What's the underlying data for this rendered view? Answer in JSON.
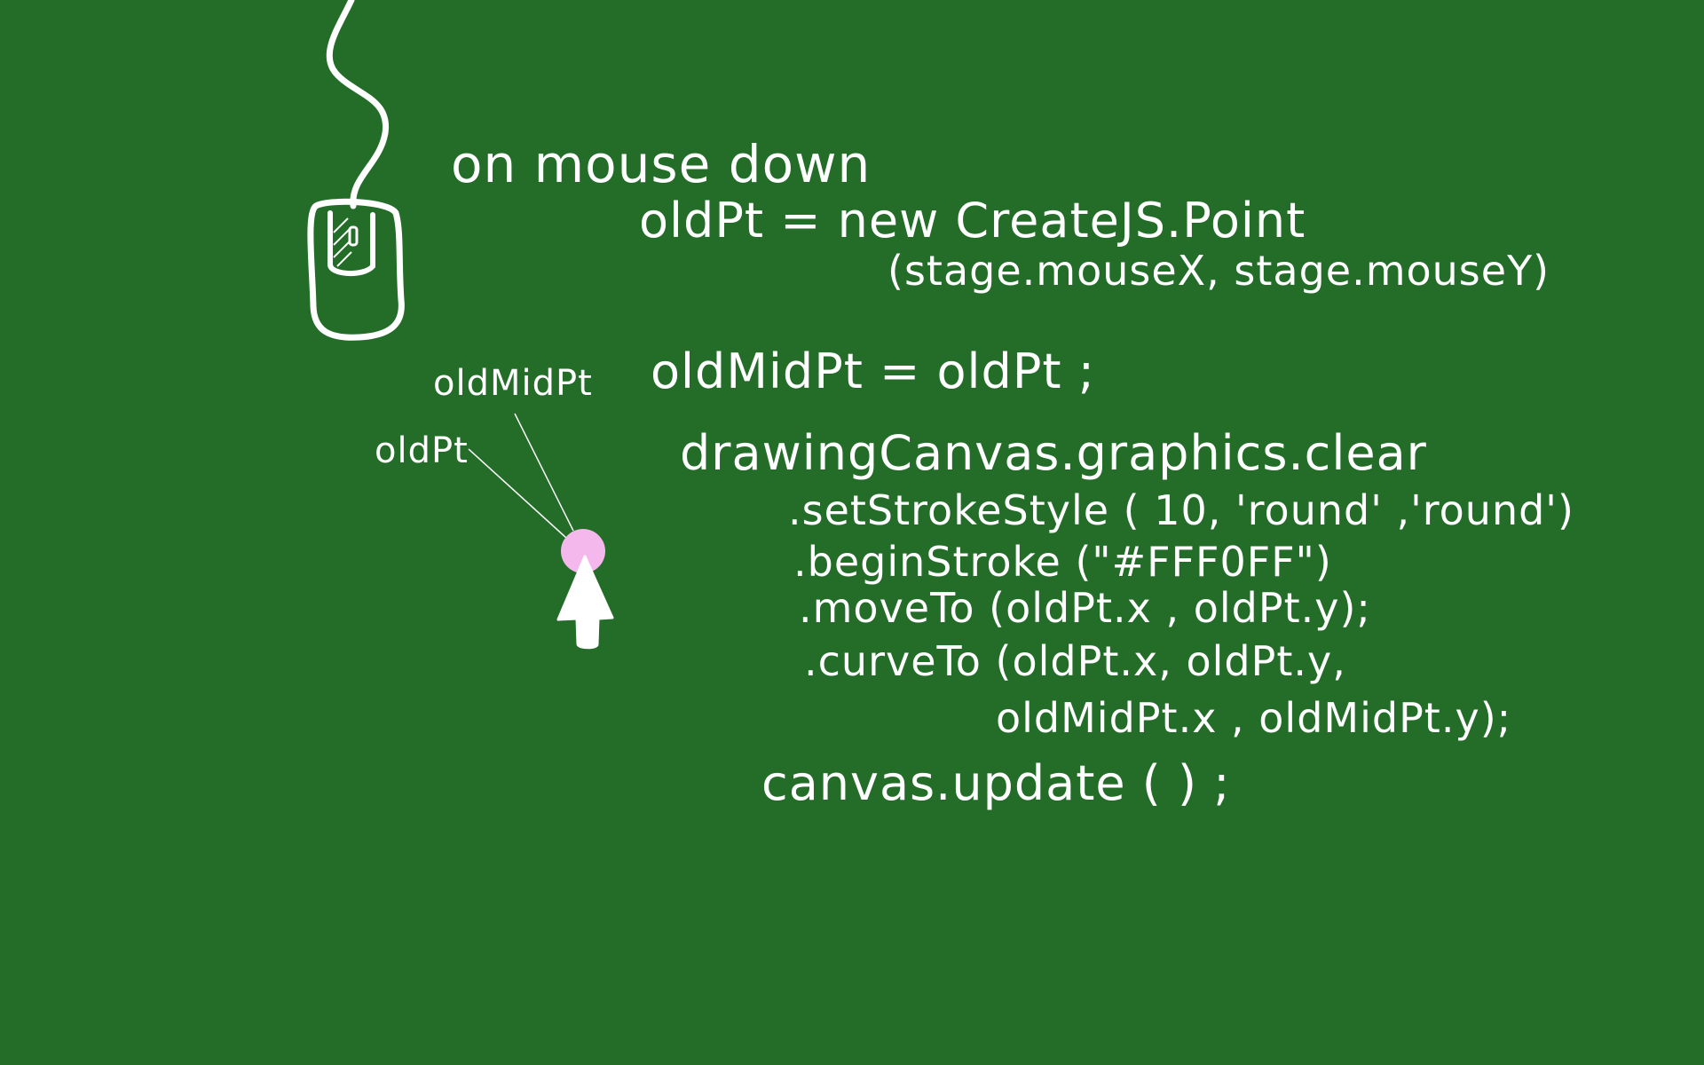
{
  "colors": {
    "board": "#236d29",
    "chalk": "#ffffff",
    "cursor_dot": "#f4b8ec"
  },
  "icons": {
    "mouse": "mouse-icon",
    "cursor": "arrow-cursor-icon"
  },
  "heading": "on mouse down",
  "code": {
    "line1": "oldPt = new CreateJS.Point",
    "line2": "(stage.mouseX, stage.mouseY)",
    "line3": "oldMidPt = oldPt ;",
    "line4": "drawingCanvas.graphics.clear",
    "line5": ".setStrokeStyle ( 10, 'round' ,'round')",
    "line6": ".beginStroke (\"#FFF0FF\")",
    "line7": ".moveTo (oldPt.x , oldPt.y);",
    "line8": ".curveTo (oldPt.x, oldPt.y,",
    "line9": "oldMidPt.x , oldMidPt.y);",
    "line10": "canvas.update ( ) ;"
  },
  "labels": {
    "old_mid_pt": "oldMidPt",
    "old_pt": "oldPt"
  }
}
